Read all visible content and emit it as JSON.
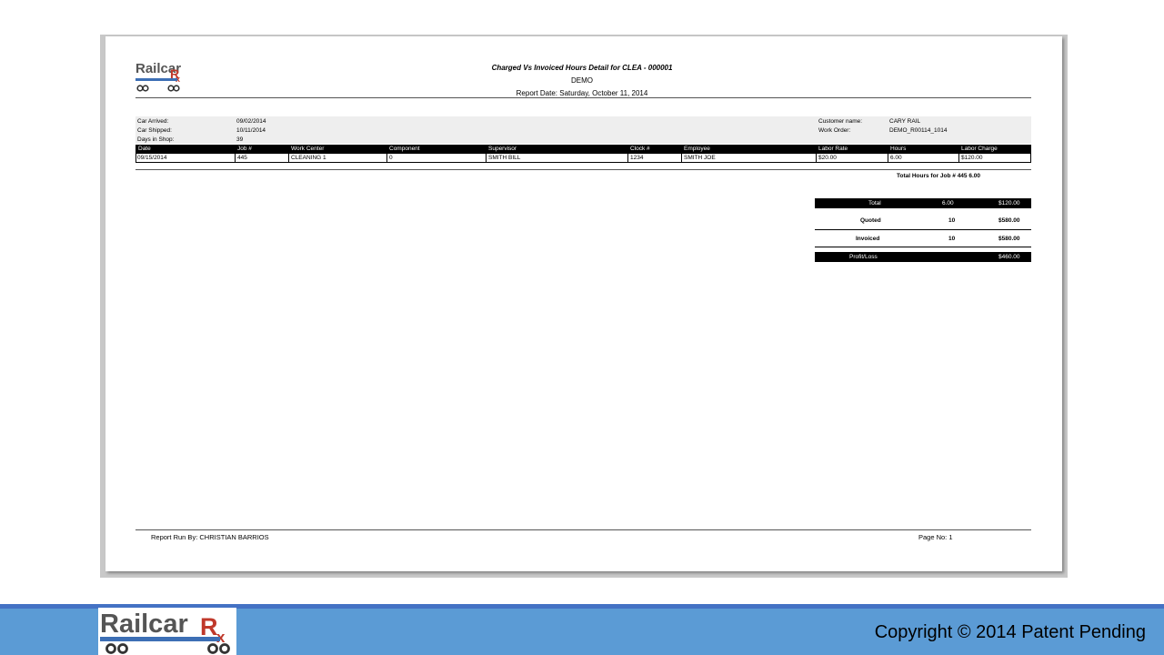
{
  "report": {
    "title": "Charged Vs Invoiced Hours Detail for CLEA - 000001",
    "subtitle": "DEMO",
    "date": "Report Date: Saturday, October 11, 2014",
    "logo_text": "RailcarRx"
  },
  "info": {
    "car_arrived_label": "Car Arrived:",
    "car_arrived_value": "09/02/2014",
    "car_shipped_label": "Car Shipped:",
    "car_shipped_value": "10/11/2014",
    "days_in_shop_label": "Days in Shop:",
    "days_in_shop_value": "39",
    "customer_name_label": "Customer name:",
    "customer_name_value": "CARY RAIL",
    "work_order_label": "Work Order:",
    "work_order_value": "DEMO_R00114_1014"
  },
  "table": {
    "columns": [
      "Date",
      "Job #",
      "Work Center",
      "Component",
      "Supervisor",
      "Clock #",
      "Employee",
      "Labor Rate",
      "Hours",
      "Labor Charge"
    ],
    "rows": [
      [
        "09/15/2014",
        "445",
        "CLEANING 1",
        "0",
        "SMITH BILL",
        "1234",
        "SMITH JOE",
        "$20.00",
        "6.00",
        "$120.00"
      ]
    ]
  },
  "total_hours": "Total Hours for Job # 445   6.00",
  "summary": {
    "total_label": "Total",
    "total_hours": "6.00",
    "total_amount": "$120.00",
    "quoted_label": "Quoted",
    "quoted_hours": "10",
    "quoted_amount": "$580.00",
    "invoiced_label": "Invoiced",
    "invoiced_hours": "10",
    "invoiced_amount": "$580.00",
    "profit_label": "Profit/Loss",
    "profit_amount": "$460.00"
  },
  "footer": {
    "run_by": "Report Run By: CHRISTIAN BARRIOS",
    "page_no": "Page No: 1"
  },
  "slide_footer": {
    "copyright": "Copyright © 2014  Patent Pending",
    "logo_text": "RailcarRx"
  },
  "colors": {
    "footer_bar": "#5b9bd5",
    "footer_border": "#4472c4",
    "logo_gray": "#555555",
    "logo_red": "#c0392b"
  }
}
